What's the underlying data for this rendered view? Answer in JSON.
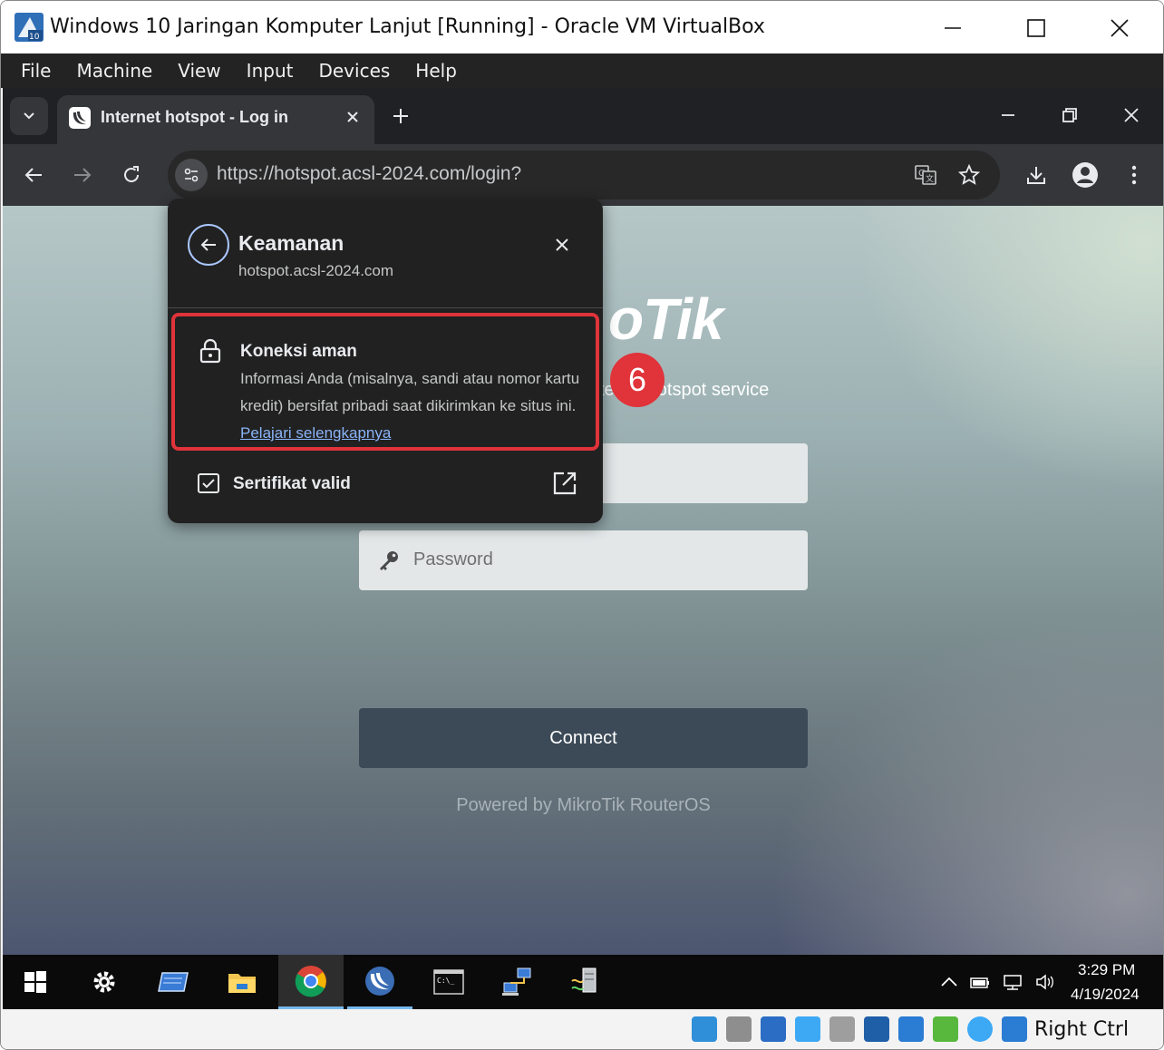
{
  "vbox": {
    "title": "Windows 10 Jaringan Komputer Lanjut [Running] - Oracle VM VirtualBox",
    "menu": [
      "File",
      "Machine",
      "View",
      "Input",
      "Devices",
      "Help"
    ],
    "host_key": "Right Ctrl"
  },
  "browser": {
    "tab": {
      "title": "Internet hotspot - Log in",
      "icon": "mikrotik-favicon"
    },
    "url": "https://hotspot.acsl-2024.com/login?"
  },
  "site_info_popup": {
    "title": "Keamanan",
    "domain": "hotspot.acsl-2024.com",
    "connection": {
      "title": "Koneksi aman",
      "description": "Informasi Anda (misalnya, sandi atau nomor kartu kredit) bersifat pribadi saat dikirimkan ke situs ini.",
      "link": "Pelajari selengkapnya"
    },
    "certificate": "Sertifikat valid",
    "highlight_color": "#e0333a"
  },
  "page": {
    "logo_fragment": "oTik",
    "tagline_fragment_left": "te",
    "tagline_fragment_right": "hotspot service",
    "password_placeholder": "Password",
    "connect_label": "Connect",
    "powered_by": "Powered by MikroTik RouterOS"
  },
  "annotation": {
    "step_number": "6"
  },
  "taskbar": {
    "apps": [
      "start-icon",
      "settings-icon",
      "tablet-icon",
      "file-explorer-icon",
      "chrome-icon",
      "winbox-icon",
      "terminal-icon",
      "network-icon",
      "server-icon"
    ],
    "time": "3:29 PM",
    "date": "4/19/2024"
  }
}
